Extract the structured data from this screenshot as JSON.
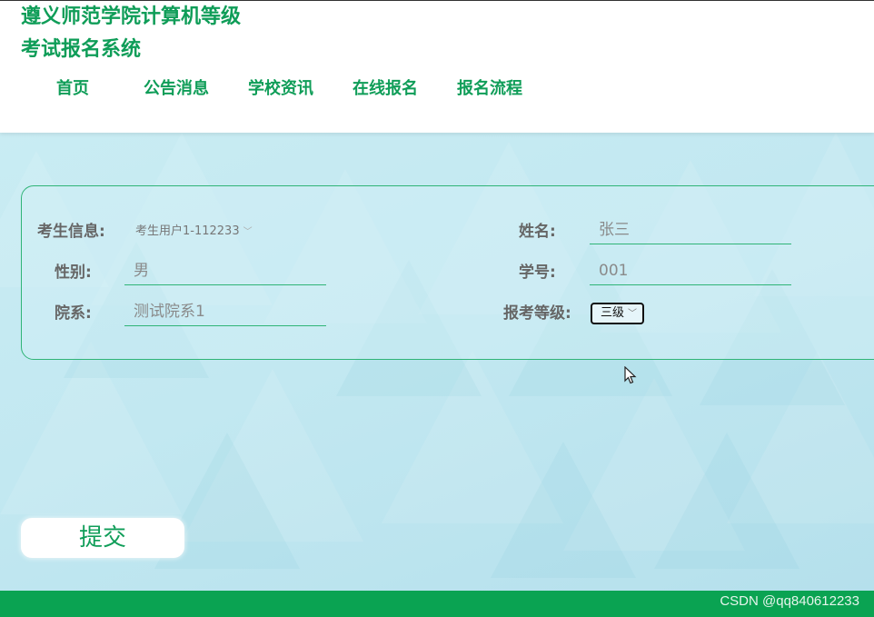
{
  "site": {
    "title_line1": "遵义师范学院计算机等级",
    "title_line2": "考试报名系统"
  },
  "nav": {
    "items": [
      {
        "label": "首页"
      },
      {
        "label": "公告消息"
      },
      {
        "label": "学校资讯"
      },
      {
        "label": "在线报名"
      },
      {
        "label": "报名流程"
      }
    ]
  },
  "form": {
    "examinee_info_label": "考生信息:",
    "examinee_info_value": "考生用户1-112233",
    "name_label": "姓名:",
    "name_value": "张三",
    "gender_label": "性别:",
    "gender_value": "男",
    "student_id_label": "学号:",
    "student_id_value": "001",
    "department_label": "院系:",
    "department_value": "测试院系1",
    "level_label": "报考等级:",
    "level_value": "三级",
    "chevron": "﹀"
  },
  "actions": {
    "submit_label": "提交"
  },
  "watermark": "CSDN @qq840612233",
  "colors": {
    "brand_green": "#0f9d58",
    "footer_green": "#0aa352",
    "border_green": "#2fb477",
    "background": "#c2e8f1"
  }
}
